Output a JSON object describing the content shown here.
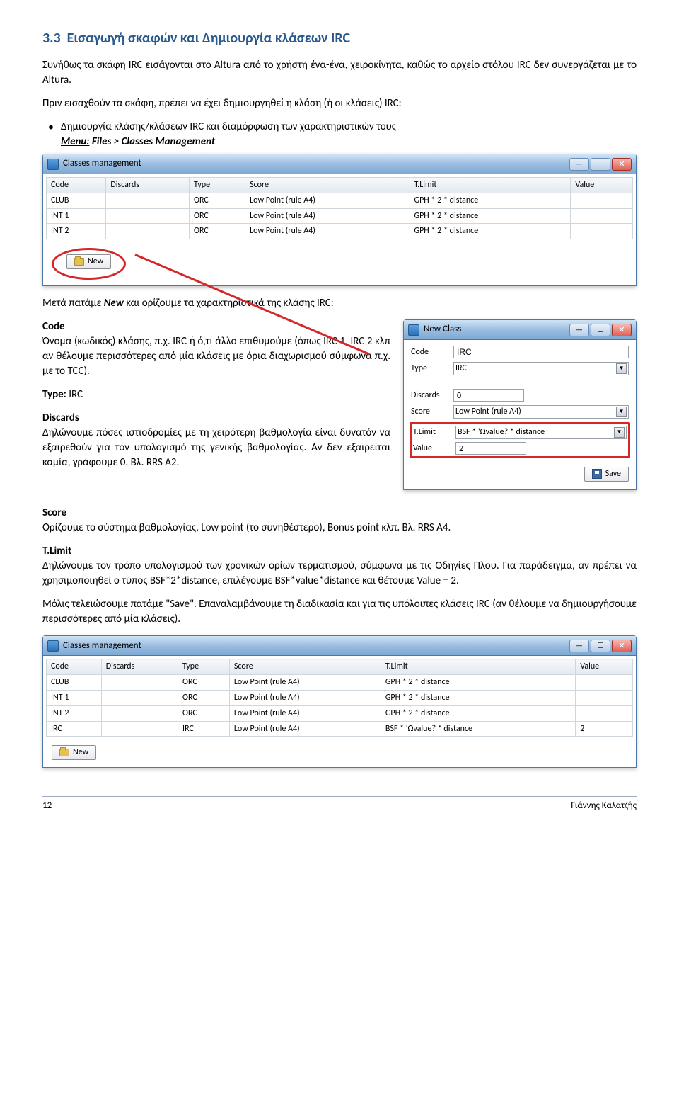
{
  "section": {
    "number": "3.3",
    "title": "Εισαγωγή σκαφών και Δημιουργία κλάσεων IRC"
  },
  "para1": "Συνήθως τα σκάφη IRC εισάγονται στο Altura από το χρήστη ένα-ένα, χειροκίνητα, καθώς το αρχείο στόλου IRC δεν συνεργάζεται με το Altura.",
  "para2": "Πριν εισαχθούν τα σκάφη, πρέπει να έχει δημιουργηθεί η κλάση (ή οι κλάσεις) IRC:",
  "bullet1": "Δημιουργία κλάσης/κλάσεων IRC και διαμόρφωση των χαρακτηριστικών τους",
  "menu_label": "Menu:",
  "menu_path": "Files > Classes Management",
  "window": {
    "title": "Classes management",
    "columns": [
      "Code",
      "Discards",
      "Type",
      "Score",
      "T.Limit",
      "Value"
    ]
  },
  "rows1": [
    {
      "code": "CLUB",
      "discards": "",
      "type": "ORC",
      "score": "Low Point (rule A4)",
      "tlimit": "GPH * 2 * distance",
      "value": ""
    },
    {
      "code": "INT 1",
      "discards": "",
      "type": "ORC",
      "score": "Low Point (rule A4)",
      "tlimit": "GPH * 2 * distance",
      "value": ""
    },
    {
      "code": "INT 2",
      "discards": "",
      "type": "ORC",
      "score": "Low Point (rule A4)",
      "tlimit": "GPH * 2 * distance",
      "value": ""
    }
  ],
  "new_btn": "New",
  "para3": "Μετά πατάμε New και ορίζουμε τα χαρακτηριστικά της κλάσης IRC:",
  "code": {
    "heading": "Code",
    "text": "Όνομα (κωδικός) κλάσης, π.χ. IRC ή ό,τι άλλο επιθυμούμε (όπως IRC 1, IRC 2 κλπ αν θέλουμε περισσότερες από μία κλάσεις με όρια διαχωρισμού σύμφωνα π.χ. με το TCC)."
  },
  "type": {
    "heading": "Type:",
    "text": "IRC"
  },
  "discards": {
    "heading": "Discards",
    "text": "Δηλώνουμε πόσες ιστιοδρομίες με τη χειρότερη βαθμολογία είναι δυνατόν να εξαιρεθούν για τον υπολογισμό της γενικής βαθμολογίας. Αν δεν εξαιρείται καμία, γράφουμε 0. Βλ. RRS A2."
  },
  "newclass": {
    "title": "New Class",
    "labels": {
      "code": "Code",
      "type": "Type",
      "discards": "Discards",
      "score": "Score",
      "tlimit": "T.Limit",
      "value": "Value"
    },
    "values": {
      "code": "IRC",
      "type": "IRC",
      "discards": "0",
      "score": "Low Point (rule A4)",
      "tlimit": "BSF * 'Ωvalue? * distance",
      "value": "2"
    },
    "save": "Save"
  },
  "score": {
    "heading": "Score",
    "text": "Ορίζουμε το σύστημα βαθμολογίας, Low point (το συνηθέστερο), Bonus point κλπ. Βλ. RRS A4."
  },
  "tlimit": {
    "heading": "T.Limit",
    "text": "Δηλώνουμε τον τρόπο υπολογισμού των χρονικών ορίων τερματισμού, σύμφωνα με τις Οδηγίες Πλου. Για παράδειγμα, αν πρέπει να χρησιμοποιηθεί ο τύπος BSF*2*distance, επιλέγουμε BSF*value*distance και θέτουμε Value = 2."
  },
  "para_final": "Μόλις τελειώσουμε πατάμε \"Save\". Επαναλαμβάνουμε τη διαδικασία και για τις υπόλοιπες κλάσεις IRC (αν θέλουμε να δημιουργήσουμε περισσότερες από μία κλάσεις).",
  "rows2": [
    {
      "code": "CLUB",
      "discards": "",
      "type": "ORC",
      "score": "Low Point (rule A4)",
      "tlimit": "GPH * 2 * distance",
      "value": ""
    },
    {
      "code": "INT 1",
      "discards": "",
      "type": "ORC",
      "score": "Low Point (rule A4)",
      "tlimit": "GPH * 2 * distance",
      "value": ""
    },
    {
      "code": "INT 2",
      "discards": "",
      "type": "ORC",
      "score": "Low Point (rule A4)",
      "tlimit": "GPH * 2 * distance",
      "value": ""
    },
    {
      "code": "IRC",
      "discards": "",
      "type": "IRC",
      "score": "Low Point (rule A4)",
      "tlimit": "BSF * 'Ωvalue? * distance",
      "value": "2"
    }
  ],
  "footer": {
    "page": "12",
    "author": "Γιάννης Καλατζής"
  }
}
